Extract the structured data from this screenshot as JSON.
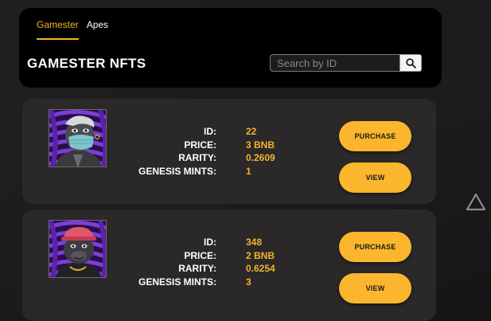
{
  "header": {
    "tabs": [
      {
        "label": "Gamester",
        "active": true
      },
      {
        "label": "Apes",
        "active": false
      }
    ],
    "title": "GAMESTER NFTS",
    "search": {
      "placeholder": "Search by ID",
      "value": ""
    }
  },
  "labels": {
    "id": "ID:",
    "price": "PRICE:",
    "rarity": "RARITY:",
    "genesis_mints": "GENESIS MINTS:"
  },
  "buttons": {
    "purchase": "PURCHASE",
    "view": "VIEW"
  },
  "nfts": [
    {
      "id": "22",
      "price": "3 BNB",
      "rarity": "0.2609",
      "genesis_mints": "1",
      "accessory": "face mask"
    },
    {
      "id": "348",
      "price": "2 BNB",
      "rarity": "0.6254",
      "genesis_mints": "3",
      "accessory": "red hat"
    }
  ],
  "colors": {
    "accent": "#f5b32b",
    "button": "#fbb62d",
    "card": "#2b2829",
    "header_bg": "#000000",
    "page_bg": "#1c1b1d"
  },
  "icons": {
    "search": "search-icon",
    "nav": "triangle-up-icon"
  }
}
